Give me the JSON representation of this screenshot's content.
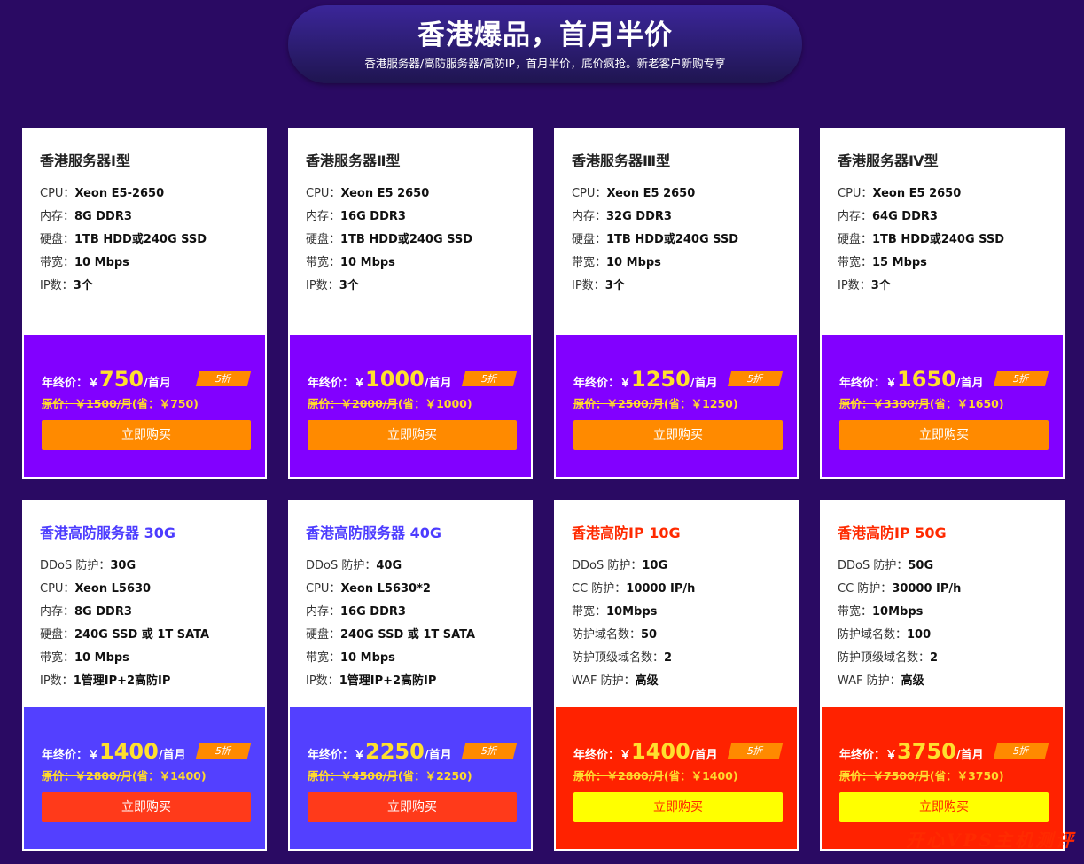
{
  "banner": {
    "title": "香港爆品，首月半价",
    "subtitle": "香港服务器/高防服务器/高防IP，首月半价，底价疯抢。新老客户新购专享"
  },
  "cards": [
    {
      "name": "香港服务器Ⅰ型",
      "specs": [
        {
          "label": "CPU：",
          "value": "Xeon E5-2650"
        },
        {
          "label": "内存：",
          "value": "8G DDR3"
        },
        {
          "label": "硬盘：",
          "value": "1TB HDD或240G SSD"
        },
        {
          "label": "带宽：",
          "value": "10 Mbps"
        },
        {
          "label": "IP数：",
          "value": "3个"
        }
      ],
      "price_label": "年终价：",
      "currency": "￥",
      "price": "750",
      "unit": "/首月",
      "badge": "5折",
      "orig_label": "原价：",
      "orig_price": "￥1500/月",
      "save": "(省：￥750)",
      "buy": "立即购买"
    },
    {
      "name": "香港服务器Ⅱ型",
      "specs": [
        {
          "label": "CPU：",
          "value": "Xeon E5 2650"
        },
        {
          "label": "内存：",
          "value": "16G DDR3"
        },
        {
          "label": "硬盘：",
          "value": "1TB HDD或240G SSD"
        },
        {
          "label": "带宽：",
          "value": "10 Mbps"
        },
        {
          "label": "IP数：",
          "value": "3个"
        }
      ],
      "price_label": "年终价：",
      "currency": "￥",
      "price": "1000",
      "unit": "/首月",
      "badge": "5折",
      "orig_label": "原价：",
      "orig_price": "￥2000/月",
      "save": "(省：￥1000)",
      "buy": "立即购买"
    },
    {
      "name": "香港服务器Ⅲ型",
      "specs": [
        {
          "label": "CPU：",
          "value": "Xeon E5 2650"
        },
        {
          "label": "内存：",
          "value": "32G DDR3"
        },
        {
          "label": "硬盘：",
          "value": "1TB HDD或240G SSD"
        },
        {
          "label": "带宽：",
          "value": "10 Mbps"
        },
        {
          "label": "IP数：",
          "value": "3个"
        }
      ],
      "price_label": "年终价：",
      "currency": "￥",
      "price": "1250",
      "unit": "/首月",
      "badge": "5折",
      "orig_label": "原价：",
      "orig_price": "￥2500/月",
      "save": "(省：￥1250)",
      "buy": "立即购买"
    },
    {
      "name": "香港服务器Ⅳ型",
      "specs": [
        {
          "label": "CPU：",
          "value": "Xeon E5 2650"
        },
        {
          "label": "内存：",
          "value": "64G DDR3"
        },
        {
          "label": "硬盘：",
          "value": "1TB HDD或240G SSD"
        },
        {
          "label": "带宽：",
          "value": "15 Mbps"
        },
        {
          "label": "IP数：",
          "value": "3个"
        }
      ],
      "price_label": "年终价：",
      "currency": "￥",
      "price": "1650",
      "unit": "/首月",
      "badge": "5折",
      "orig_label": "原价：",
      "orig_price": "￥3300/月",
      "save": "(省：￥1650)",
      "buy": "立即购买"
    },
    {
      "name": "香港高防服务器 30G",
      "specs": [
        {
          "label": "DDoS 防护：",
          "value": "30G"
        },
        {
          "label": "CPU：",
          "value": "Xeon L5630"
        },
        {
          "label": "内存：",
          "value": "8G DDR3"
        },
        {
          "label": "硬盘：",
          "value": "240G SSD 或 1T SATA"
        },
        {
          "label": "带宽：",
          "value": "10 Mbps"
        },
        {
          "label": "IP数：",
          "value": "1管理IP+2高防IP"
        }
      ],
      "price_label": "年终价：",
      "currency": "￥",
      "price": "1400",
      "unit": "/首月",
      "badge": "5折",
      "orig_label": "原价：",
      "orig_price": "￥2800/月",
      "save": "(省：￥1400)",
      "buy": "立即购买"
    },
    {
      "name": "香港高防服务器 40G",
      "specs": [
        {
          "label": "DDoS 防护：",
          "value": "40G"
        },
        {
          "label": "CPU：",
          "value": "Xeon L5630*2"
        },
        {
          "label": "内存：",
          "value": "16G DDR3"
        },
        {
          "label": "硬盘：",
          "value": "240G SSD 或 1T SATA"
        },
        {
          "label": "带宽：",
          "value": "10 Mbps"
        },
        {
          "label": "IP数：",
          "value": "1管理IP+2高防IP"
        }
      ],
      "price_label": "年终价：",
      "currency": "￥",
      "price": "2250",
      "unit": "/首月",
      "badge": "5折",
      "orig_label": "原价：",
      "orig_price": "￥4500/月",
      "save": "(省：￥2250)",
      "buy": "立即购买"
    },
    {
      "name": "香港高防IP 10G",
      "specs": [
        {
          "label": "DDoS 防护：",
          "value": "10G"
        },
        {
          "label": "CC 防护：",
          "value": "10000 IP/h"
        },
        {
          "label": "带宽：",
          "value": "10Mbps"
        },
        {
          "label": "防护域名数：",
          "value": "50"
        },
        {
          "label": "防护顶级域名数：",
          "value": "2"
        },
        {
          "label": "WAF 防护：",
          "value": "高级"
        }
      ],
      "price_label": "年终价：",
      "currency": "￥",
      "price": "1400",
      "unit": "/首月",
      "badge": "5折",
      "orig_label": "原价：",
      "orig_price": "￥2800/月",
      "save": "(省：￥1400)",
      "buy": "立即购买"
    },
    {
      "name": "香港高防IP 50G",
      "specs": [
        {
          "label": "DDoS 防护：",
          "value": "50G"
        },
        {
          "label": "CC 防护：",
          "value": "30000 IP/h"
        },
        {
          "label": "带宽：",
          "value": "10Mbps"
        },
        {
          "label": "防护域名数：",
          "value": "100"
        },
        {
          "label": "防护顶级域名数：",
          "value": "2"
        },
        {
          "label": "WAF 防护：",
          "value": "高级"
        }
      ],
      "price_label": "年终价：",
      "currency": "￥",
      "price": "3750",
      "unit": "/首月",
      "badge": "5折",
      "orig_label": "原价：",
      "orig_price": "￥7500/月",
      "save": "(省：￥3750)",
      "buy": "立即购买"
    }
  ],
  "watermark": "开心VPS主机测评"
}
